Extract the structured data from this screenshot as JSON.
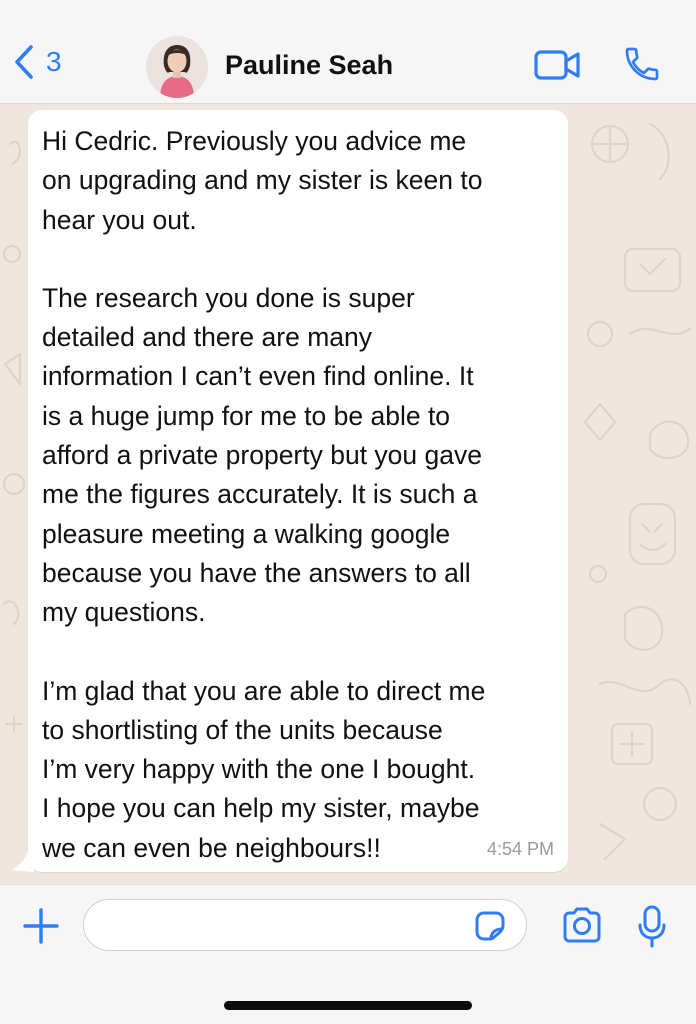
{
  "header": {
    "back_count": "3",
    "contact_name": "Pauline Seah",
    "icons": [
      "chevron-left-icon",
      "video-camera-icon",
      "phone-icon"
    ]
  },
  "message": {
    "paragraphs": [
      "Hi Cedric. Previously you advice me\non upgrading and my sister is keen to\nhear you out.",
      "The research you done is super\ndetailed and there are many\ninformation I can’t even find online. It\nis a huge jump for me to be able to\nafford a private property but you gave\nme the figures accurately. It is such a\npleasure meeting a walking google\nbecause you have the answers to all\nmy questions.",
      "I’m glad that you are able to direct me\nto shortlisting of the units because\nI’m very happy with the one I bought.\nI hope you can help my sister, maybe\nwe can even be neighbours!!"
    ],
    "time": "4:54 PM"
  },
  "composer": {
    "placeholder": "",
    "icons": [
      "plus-icon",
      "sticker-icon",
      "camera-icon",
      "microphone-icon"
    ]
  },
  "colors": {
    "accent": "#2f7cf6",
    "chat_background": "#efe7dd",
    "bubble": "#ffffff",
    "bar_background": "#f6f6f6"
  }
}
